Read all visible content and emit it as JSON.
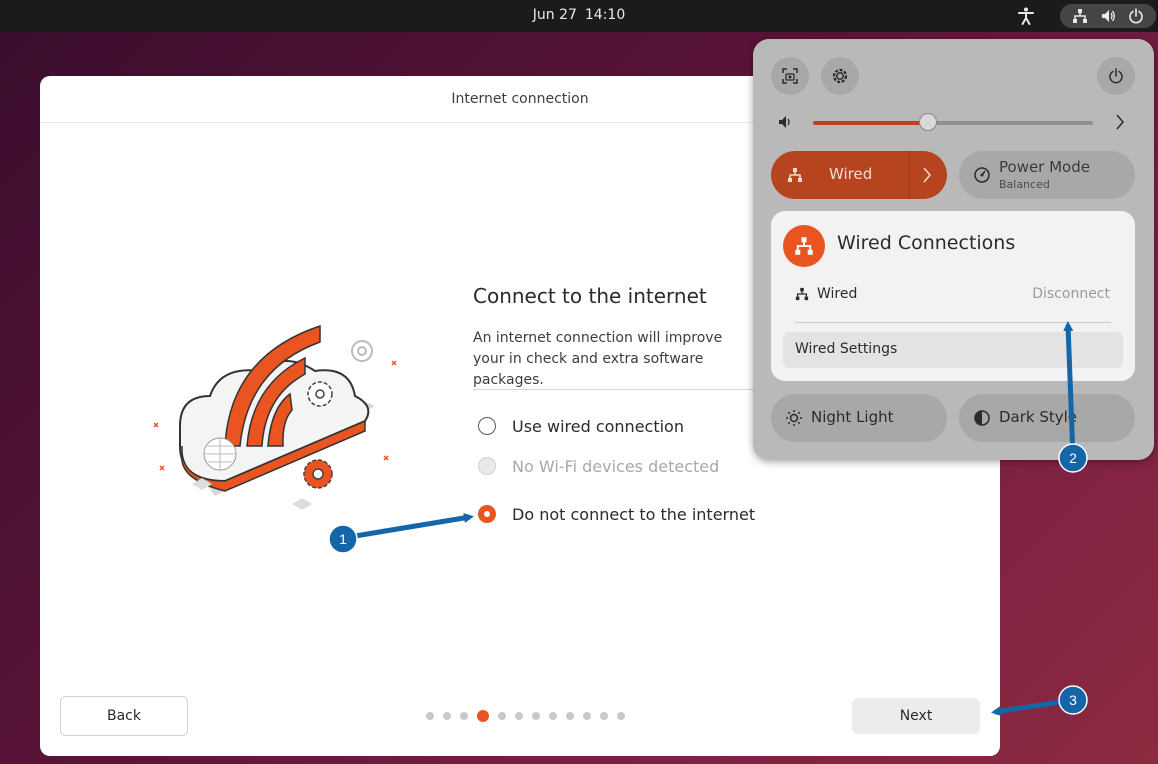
{
  "topbar": {
    "date": "Jun 27",
    "time": "14:10"
  },
  "window": {
    "title": "Internet connection",
    "heading": "Connect to the internet",
    "description": "An internet connection will improve your in check and extra software packages.",
    "options": [
      {
        "label": "Use wired connection",
        "state": "unselected"
      },
      {
        "label": "No Wi-Fi devices detected",
        "state": "disabled"
      },
      {
        "label": "Do not connect to the internet",
        "state": "selected"
      }
    ],
    "back_label": "Back",
    "next_label": "Next",
    "progress": {
      "total_steps": 12,
      "current_step": 4
    }
  },
  "quick_settings": {
    "volume_fraction": 0.41,
    "wired_label": "Wired",
    "power_mode_label": "Power Mode",
    "power_mode_value": "Balanced",
    "wired_menu": {
      "title": "Wired Connections",
      "connection_label": "Wired",
      "disconnect_label": "Disconnect",
      "settings_label": "Wired Settings"
    },
    "night_light_label": "Night Light",
    "dark_style_label": "Dark Style"
  },
  "annotations": [
    {
      "number": "1"
    },
    {
      "number": "2"
    },
    {
      "number": "3"
    }
  ],
  "colors": {
    "accent": "#e95420",
    "accent_dark": "#b5441f",
    "annotation_blue": "#1565a8"
  }
}
